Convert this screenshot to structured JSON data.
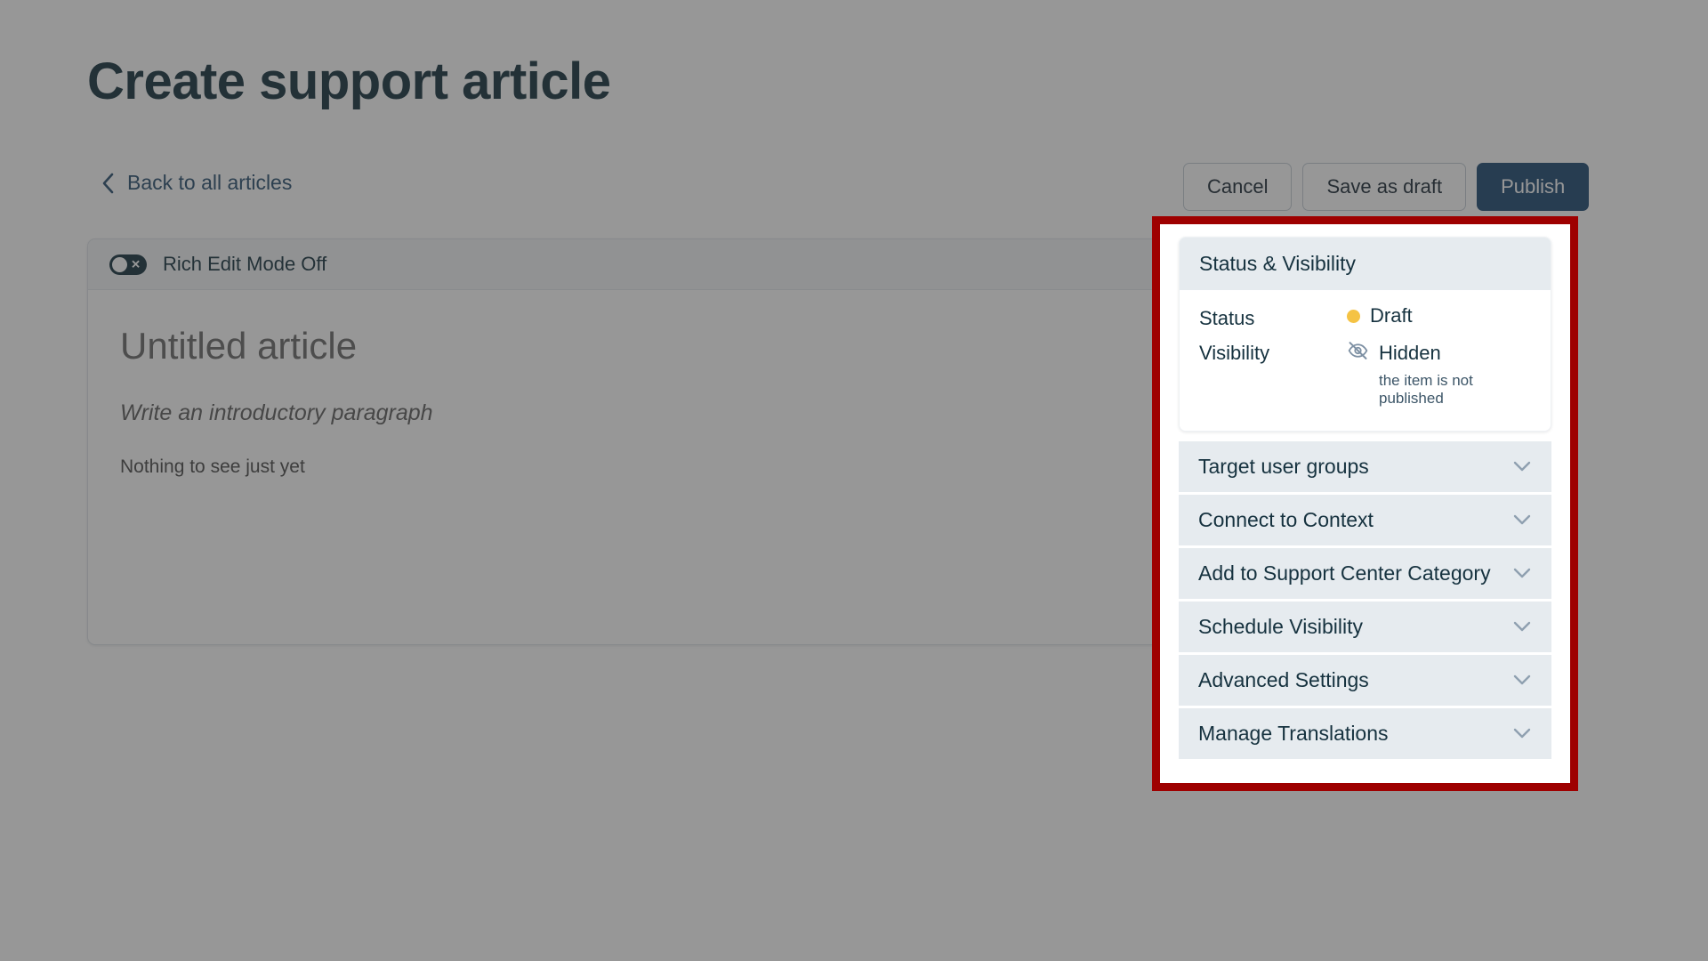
{
  "page": {
    "title": "Create support article",
    "back_link": "Back to all articles",
    "back_icon": "chevron-left-icon"
  },
  "actions": {
    "cancel": "Cancel",
    "save_draft": "Save as draft",
    "publish": "Publish",
    "primary_color": "#1f4b73"
  },
  "editor": {
    "toolbar": {
      "toggle_state": "off",
      "toggle_icon": "toggle-off-icon",
      "label": "Rich Edit Mode Off"
    },
    "title_placeholder": "Untitled article",
    "intro_placeholder": "Write an introductory paragraph",
    "body_placeholder": "Nothing to see just yet"
  },
  "highlight": {
    "color": "#9e0000"
  },
  "settings_panel": {
    "status_visibility": {
      "header": "Status & Visibility",
      "status_label": "Status",
      "status_value": "Draft",
      "status_dot_color": "#f5c344",
      "status_icon": "status-dot-icon",
      "visibility_label": "Visibility",
      "visibility_value": "Hidden",
      "visibility_icon": "eye-slash-icon",
      "visibility_help": "the item is not published"
    },
    "sections": [
      {
        "label": "Target user groups",
        "icon": "chevron-down-icon"
      },
      {
        "label": "Connect to Context",
        "icon": "chevron-down-icon"
      },
      {
        "label": "Add to Support Center Category",
        "icon": "chevron-down-icon"
      },
      {
        "label": "Schedule Visibility",
        "icon": "chevron-down-icon"
      },
      {
        "label": "Advanced Settings",
        "icon": "chevron-down-icon"
      },
      {
        "label": "Manage Translations",
        "icon": "chevron-down-icon"
      }
    ]
  }
}
